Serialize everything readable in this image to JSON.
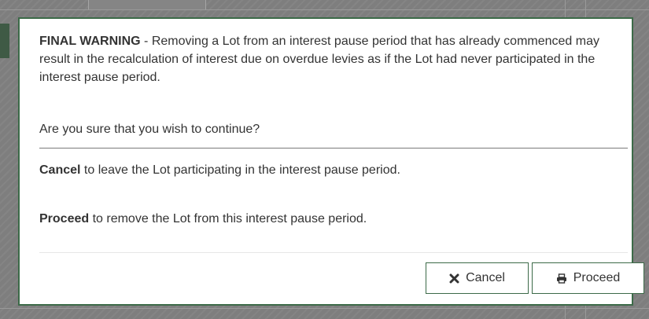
{
  "dialog": {
    "warning_heading": "FINAL WARNING",
    "warning_text": " - Removing a Lot from an interest pause period that has already commenced may result in the recalculation of interest due on overdue levies as if the Lot had never participated in the interest pause period.",
    "question": "Are you sure that you wish to continue?",
    "cancel_instruction": {
      "keyword": "Cancel",
      "text": " to leave the Lot participating in the interest pause period."
    },
    "proceed_instruction": {
      "keyword": "Proceed",
      "text": " to remove the Lot from this interest pause period."
    }
  },
  "buttons": {
    "cancel": {
      "label": "Cancel",
      "icon": "close-icon"
    },
    "proceed": {
      "label": "Proceed",
      "icon": "printer-icon"
    }
  },
  "colors": {
    "modal_border": "#3c6a48",
    "text": "#333333",
    "backdrop": "#7e7e7e"
  }
}
